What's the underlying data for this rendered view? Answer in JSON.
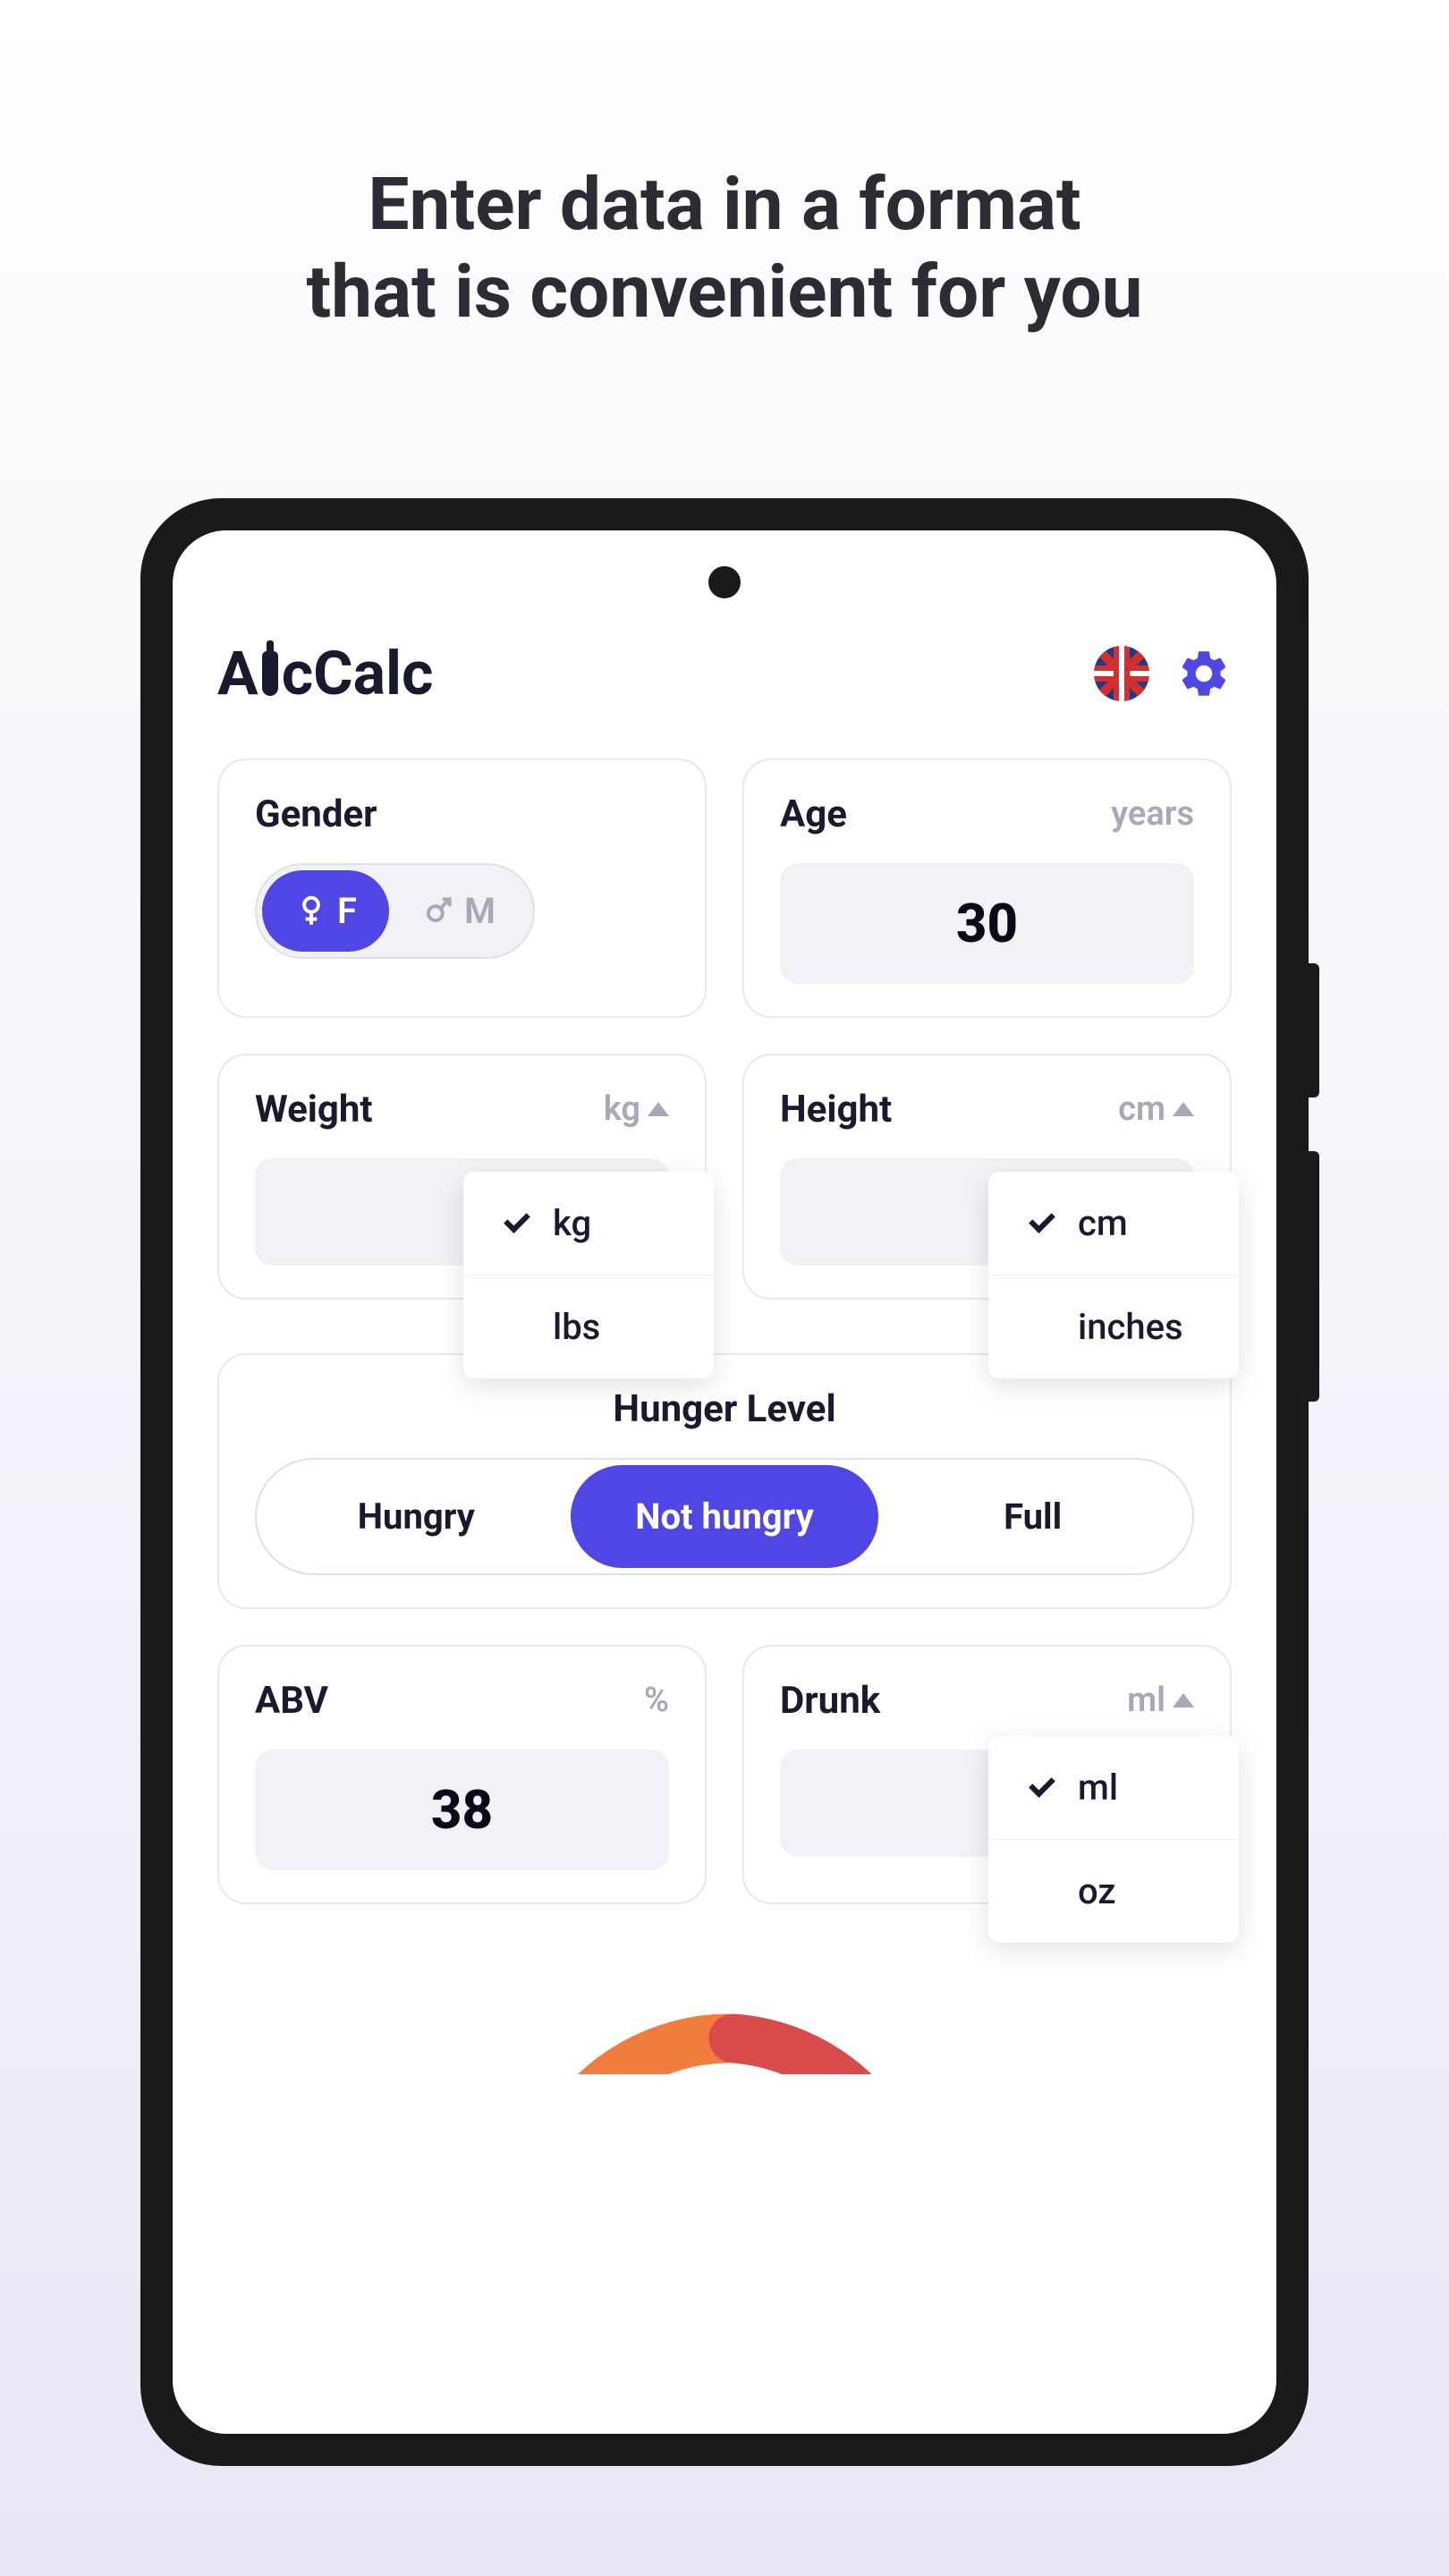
{
  "promo_title_line1": "Enter data in a format",
  "promo_title_line2": "that is convenient for you",
  "app_name": "AlcCalc",
  "gender": {
    "label": "Gender",
    "options": {
      "female": "F",
      "male": "M"
    },
    "selected": "female"
  },
  "age": {
    "label": "Age",
    "unit": "years",
    "value": "30"
  },
  "weight": {
    "label": "Weight",
    "unit": "kg",
    "options": [
      "kg",
      "lbs"
    ],
    "selected": "kg"
  },
  "height": {
    "label": "Height",
    "unit": "cm",
    "options": [
      "cm",
      "inches"
    ],
    "selected": "cm"
  },
  "hunger": {
    "label": "Hunger Level",
    "options": [
      "Hungry",
      "Not hungry",
      "Full"
    ],
    "selected": "Not hungry"
  },
  "abv": {
    "label": "ABV",
    "unit": "%",
    "value": "38"
  },
  "drunk": {
    "label": "Drunk",
    "unit": "ml",
    "options": [
      "ml",
      "oz"
    ],
    "selected": "ml"
  },
  "colors": {
    "primary": "#5046e5",
    "text": "#1a1a2e",
    "muted": "#a8a8b8"
  }
}
